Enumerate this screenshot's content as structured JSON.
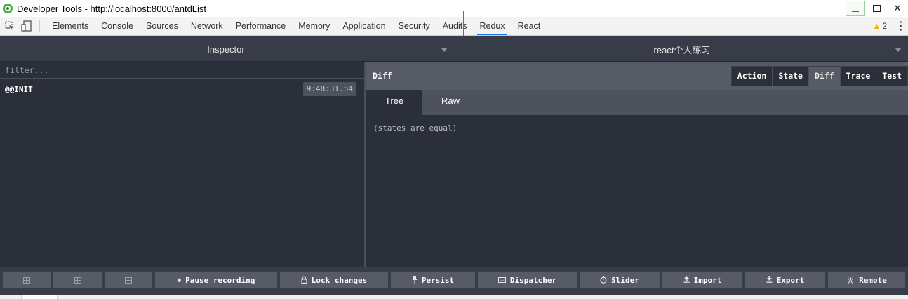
{
  "window": {
    "title": "Developer Tools - http://localhost:8000/antdList",
    "controls": [
      "minimize-icon",
      "maximize-icon",
      "close-icon"
    ],
    "close_glyph": "✕"
  },
  "devtools": {
    "tabs": [
      "Elements",
      "Console",
      "Sources",
      "Network",
      "Performance",
      "Memory",
      "Application",
      "Security",
      "Audits",
      "Redux",
      "React"
    ],
    "active_tab": "Redux",
    "warnings_count": "2",
    "highlight_color": "#e53935",
    "accent_color": "#1a73e8"
  },
  "redux": {
    "monitor": "Inspector",
    "instance": "react个人练习",
    "filter_placeholder": "filter...",
    "actions": [
      {
        "name": "@@INIT",
        "time": "9:48:31.54"
      }
    ],
    "detail": {
      "title": "Diff",
      "segments": [
        "Action",
        "State",
        "Diff",
        "Trace",
        "Test"
      ],
      "active_segment": "Diff",
      "subtabs": [
        "Tree",
        "Raw"
      ],
      "active_subtab": "Tree",
      "body_text": "(states are equal)"
    },
    "bottom_buttons": [
      {
        "label": "Pause recording",
        "icon": "pause-circle-icon"
      },
      {
        "label": "Lock changes",
        "icon": "lock-icon"
      },
      {
        "label": "Persist",
        "icon": "pin-icon"
      },
      {
        "label": "Dispatcher",
        "icon": "keyboard-icon"
      },
      {
        "label": "Slider",
        "icon": "stopwatch-icon"
      },
      {
        "label": "Import",
        "icon": "upload-icon"
      },
      {
        "label": "Export",
        "icon": "download-icon"
      },
      {
        "label": "Remote",
        "icon": "antenna-icon"
      }
    ]
  }
}
